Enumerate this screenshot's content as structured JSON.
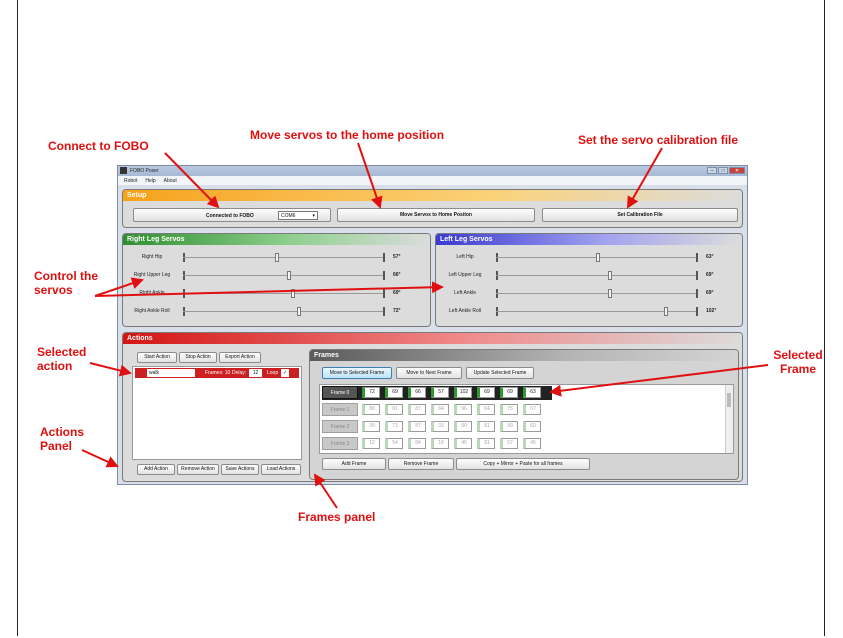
{
  "annotations": {
    "connect": "Connect to FOBO",
    "move_home": "Move servos to the home position",
    "calibration": "Set the servo calibration file",
    "control_servos": "Control the servos",
    "selected_action": "Selected action",
    "actions_panel": "Actions Panel",
    "selected_frame": "Selected Frame",
    "frames_panel": "Frames panel"
  },
  "window": {
    "title": "FOBO Poser",
    "menu": [
      "Robot",
      "Help",
      "About"
    ]
  },
  "setup": {
    "title": "Setup",
    "connect_label": "Connected to FOBO",
    "port": "COM6",
    "home_label": "Move Servos to Home Positon",
    "calibration_label": "Set Calibration File"
  },
  "right_leg": {
    "title": "Right Leg Servos",
    "servos": [
      {
        "label": "Right Hip",
        "value": "57°",
        "level": 0.47
      },
      {
        "label": "Right Upper Leg",
        "value": "66°",
        "level": 0.53
      },
      {
        "label": "Right Ankle",
        "value": "69°",
        "level": 0.55
      },
      {
        "label": "Right Ankle Roll",
        "value": "72°",
        "level": 0.58
      }
    ]
  },
  "left_leg": {
    "title": "Left Leg Servos",
    "servos": [
      {
        "label": "Left Hip",
        "value": "63°",
        "level": 0.51
      },
      {
        "label": "Left Upper Leg",
        "value": "69°",
        "level": 0.57
      },
      {
        "label": "Left Ankle",
        "value": "69°",
        "level": 0.57
      },
      {
        "label": "Left Ankle Roll",
        "value": "102°",
        "level": 0.85
      }
    ]
  },
  "actions": {
    "title": "Actions",
    "start": "Start Action",
    "stop": "Stop Action",
    "export": "Export Action",
    "selected": {
      "name": "walk",
      "frames": "Frames: 10",
      "delay_label": "Delay:",
      "delay": "12",
      "loop": "Loop",
      "loop_check": "✓"
    },
    "add": "Add Action",
    "remove": "Remove Action",
    "save": "Save Actions",
    "load": "Load Actions"
  },
  "frames": {
    "title": "Frames",
    "move_selected": "Move to Selected Frame",
    "move_next": "Move to Next Frame",
    "update_selected": "Update Selected Frame",
    "rows": [
      {
        "label": "Frame 0",
        "values": [
          "72",
          "69",
          "66",
          "57",
          "102",
          "69",
          "69",
          "63"
        ]
      },
      {
        "label": "Frame 1",
        "values": [
          "80",
          "81",
          "87",
          "64",
          "96",
          "64",
          "75",
          "67"
        ]
      },
      {
        "label": "Frame 2",
        "values": [
          "30",
          "73",
          "87",
          "33",
          "90",
          "81",
          "99",
          "60"
        ]
      },
      {
        "label": "Frame 3",
        "values": [
          "12",
          "54",
          "84",
          "18",
          "45",
          "81",
          "57",
          "45"
        ]
      }
    ],
    "add_frame": "Add Frame",
    "remove_frame": "Remove Frame",
    "copy_mirror": "Copy + Mirror + Paste for all frames"
  }
}
